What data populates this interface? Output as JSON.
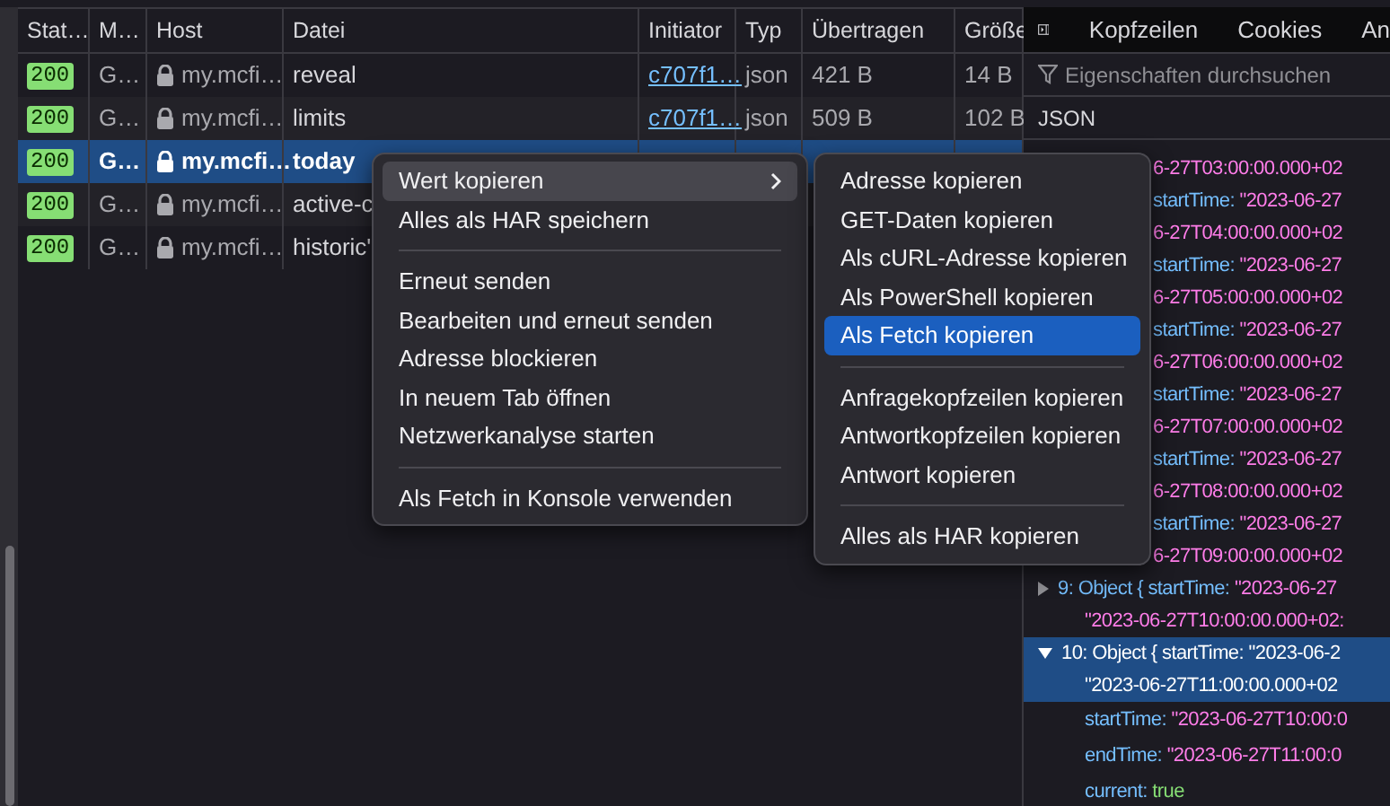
{
  "table": {
    "columns": [
      "Stat…",
      "M…",
      "Host",
      "Datei",
      "Initiator",
      "Typ",
      "Übertragen",
      "Größe"
    ],
    "rows": [
      {
        "status": "200",
        "method": "G…",
        "host": "my.mcfi…",
        "file": "reveal",
        "initiator": "c707f1…",
        "type": "json",
        "transferred": "421 B",
        "size": "14 B",
        "selected": false
      },
      {
        "status": "200",
        "method": "G…",
        "host": "my.mcfi…",
        "file": "limits",
        "initiator": "c707f1…",
        "type": "json",
        "transferred": "509 B",
        "size": "102 B",
        "selected": false
      },
      {
        "status": "200",
        "method": "G…",
        "host": "my.mcfi…",
        "file": "today",
        "selected": true
      },
      {
        "status": "200",
        "method": "G…",
        "host": "my.mcfi…",
        "file": "active-c",
        "selected": false
      },
      {
        "status": "200",
        "method": "G…",
        "host": "my.mcfi…",
        "file": "historic'",
        "selected": false
      }
    ]
  },
  "details": {
    "tabs": [
      "Kopfzeilen",
      "Cookies",
      "An"
    ],
    "filter": {
      "placeholder": "Eigenschaften durchsuchen"
    },
    "section": "JSON",
    "lines": [
      {
        "kind": "fragment",
        "value": "6-27T03:00:00.000+02"
      },
      {
        "kind": "fragment",
        "key": "startTime: ",
        "value": "\"2023-06-27"
      },
      {
        "kind": "fragment",
        "value": "6-27T04:00:00.000+02"
      },
      {
        "kind": "fragment",
        "key": "startTime: ",
        "value": "\"2023-06-27"
      },
      {
        "kind": "fragment",
        "value": "6-27T05:00:00.000+02"
      },
      {
        "kind": "fragment",
        "key": "startTime: ",
        "value": "\"2023-06-27"
      },
      {
        "kind": "fragment",
        "value": "6-27T06:00:00.000+02"
      },
      {
        "kind": "fragment",
        "key": "startTime: ",
        "value": "\"2023-06-27"
      },
      {
        "kind": "fragment",
        "value": "6-27T07:00:00.000+02"
      },
      {
        "kind": "fragment",
        "key": "startTime: ",
        "value": "\"2023-06-27"
      },
      {
        "kind": "fragment",
        "value": "6-27T08:00:00.000+02"
      },
      {
        "kind": "fragment",
        "key": "startTime: ",
        "value": "\"2023-06-27"
      },
      {
        "kind": "fragment",
        "value": "6-27T09:00:00.000+02"
      },
      {
        "kind": "object",
        "expanded": false,
        "selected": false,
        "key": "9: Object { startTime: ",
        "value": "\"2023-06-27",
        "continuation": "\"2023-06-27T10:00:00.000+02:"
      },
      {
        "kind": "object",
        "expanded": true,
        "selected": true,
        "key": "10: Object { startTime: ",
        "value": "\"2023-06-2",
        "continuation": "\"2023-06-27T11:00:00.000+02"
      },
      {
        "kind": "prop",
        "key": "startTime: ",
        "value": "\"2023-06-27T10:00:0"
      },
      {
        "kind": "prop",
        "key": "endTime: ",
        "value": "\"2023-06-27T11:00:0"
      },
      {
        "kind": "bool_prop",
        "key": "current: ",
        "value": "true"
      }
    ]
  },
  "context_menu": {
    "items": [
      {
        "kind": "item",
        "label": "Wert kopieren",
        "submenu": true,
        "selected": true
      },
      {
        "kind": "item",
        "label": "Alles als HAR speichern",
        "submenu": false,
        "selected": false
      },
      {
        "kind": "separator"
      },
      {
        "kind": "item",
        "label": "Erneut senden",
        "submenu": false,
        "selected": false
      },
      {
        "kind": "item",
        "label": "Bearbeiten und erneut senden",
        "submenu": false,
        "selected": false
      },
      {
        "kind": "item",
        "label": "Adresse blockieren",
        "submenu": false,
        "selected": false
      },
      {
        "kind": "item",
        "label": "In neuem Tab öffnen",
        "submenu": false,
        "selected": false
      },
      {
        "kind": "item",
        "label": "Netzwerkanalyse starten",
        "submenu": false,
        "selected": false
      },
      {
        "kind": "separator"
      },
      {
        "kind": "item",
        "label": "Als Fetch in Konsole verwenden",
        "submenu": false,
        "selected": false
      }
    ]
  },
  "submenu": {
    "items": [
      {
        "kind": "item",
        "label": "Adresse kopieren",
        "selected": false
      },
      {
        "kind": "item",
        "label": "GET-Daten kopieren",
        "selected": false
      },
      {
        "kind": "item",
        "label": "Als cURL-Adresse kopieren",
        "selected": false
      },
      {
        "kind": "item",
        "label": "Als PowerShell kopieren",
        "selected": false
      },
      {
        "kind": "item",
        "label": "Als Fetch kopieren",
        "selected": true
      },
      {
        "kind": "separator"
      },
      {
        "kind": "item",
        "label": "Anfragekopfzeilen kopieren",
        "selected": false
      },
      {
        "kind": "item",
        "label": "Antwortkopfzeilen kopieren",
        "selected": false
      },
      {
        "kind": "item",
        "label": "Antwort kopieren",
        "selected": false
      },
      {
        "kind": "separator"
      },
      {
        "kind": "item",
        "label": "Alles als HAR kopieren",
        "selected": false
      }
    ]
  }
}
